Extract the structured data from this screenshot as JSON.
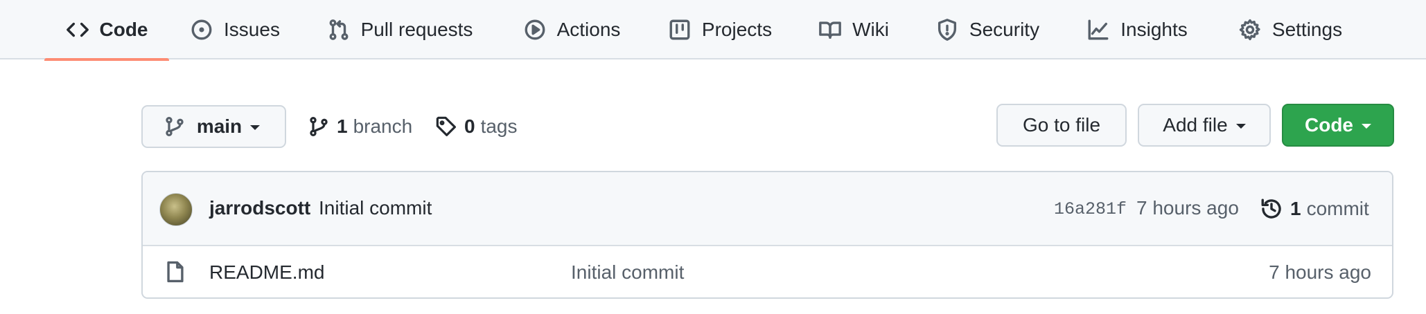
{
  "nav": {
    "tabs": [
      {
        "label": "Code",
        "icon": "code-icon",
        "selected": true
      },
      {
        "label": "Issues",
        "icon": "issue-opened-icon"
      },
      {
        "label": "Pull requests",
        "icon": "git-pull-request-icon"
      },
      {
        "label": "Actions",
        "icon": "play-icon"
      },
      {
        "label": "Projects",
        "icon": "table-icon"
      },
      {
        "label": "Wiki",
        "icon": "book-icon"
      },
      {
        "label": "Security",
        "icon": "shield-icon"
      },
      {
        "label": "Insights",
        "icon": "graph-icon"
      },
      {
        "label": "Settings",
        "icon": "gear-icon"
      }
    ]
  },
  "branch_bar": {
    "branch_name": "main",
    "branch_count": "1",
    "branch_label": "branch",
    "tag_count": "0",
    "tag_label": "tags",
    "go_to_file": "Go to file",
    "add_file": "Add file",
    "code_button": "Code"
  },
  "commit": {
    "author": "jarrodscott",
    "message": "Initial commit",
    "sha": "16a281f",
    "age": "7 hours ago",
    "commit_count": "1",
    "commit_label": "commit"
  },
  "files": [
    {
      "name": "README.md",
      "last_commit": "Initial commit",
      "age": "7 hours ago",
      "icon": "file-icon"
    }
  ],
  "colors": {
    "accent_underline": "#fd8c73",
    "primary_button": "#2da44e",
    "muted_text": "#57606a"
  }
}
